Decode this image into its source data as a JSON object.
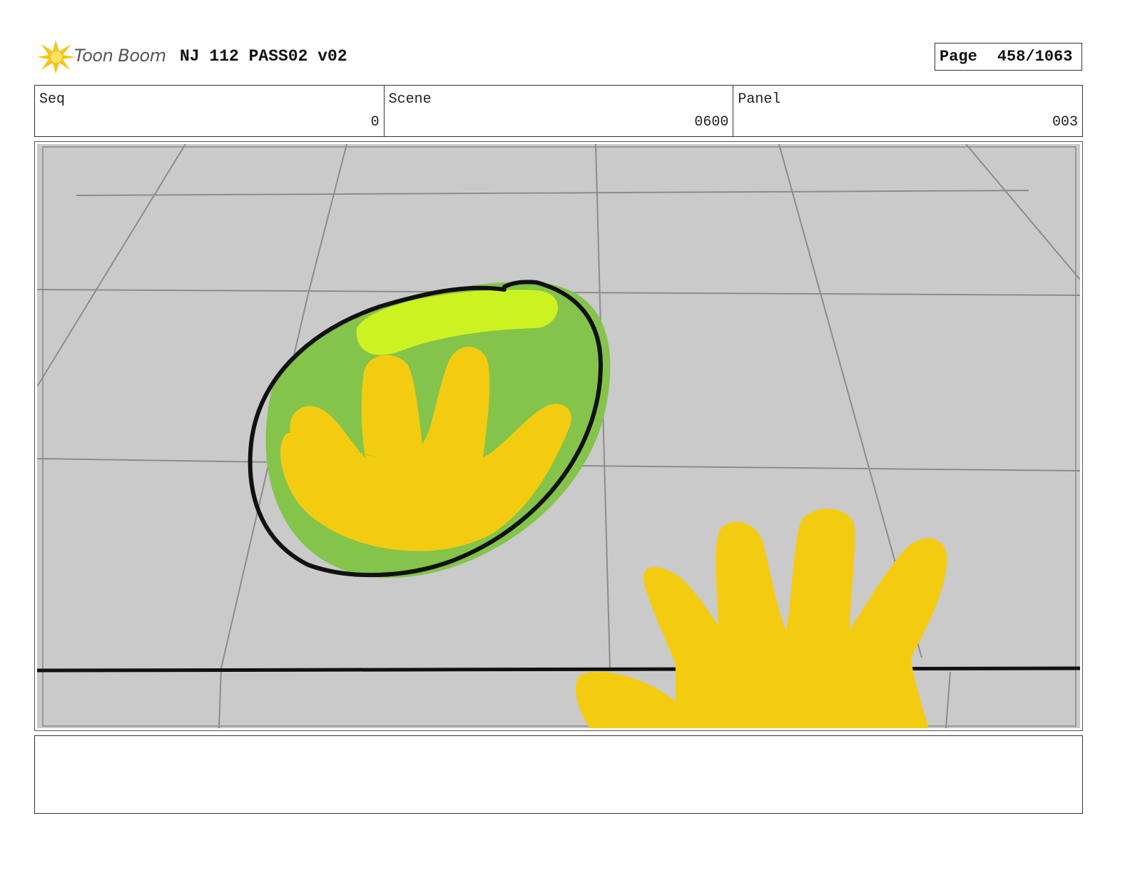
{
  "header": {
    "logo_text": "Toon Boom",
    "title": "NJ 112 PASS02 v02",
    "page_label": "Page",
    "page_number": "458/1063"
  },
  "meta": {
    "seq_label": "Seq",
    "seq_value": "0",
    "scene_label": "Scene",
    "scene_value": "0600",
    "panel_label": "Panel",
    "panel_value": "003"
  },
  "colors": {
    "floor": "#cacaca",
    "grid_lines": "#8c8c8c",
    "ball_green": "#84c44a",
    "ball_highlight": "#cdf222",
    "hand_yellow": "#f3cc12",
    "outline": "#111111"
  },
  "notes": ""
}
